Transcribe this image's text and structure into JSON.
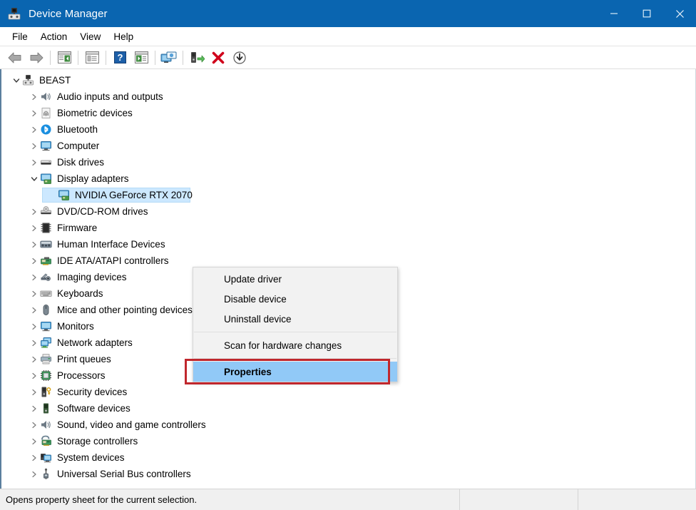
{
  "window": {
    "title": "Device Manager",
    "icon": "device-manager-icon",
    "titlebar_color": "#0a65b0"
  },
  "caption_buttons": [
    {
      "name": "minimize-button",
      "glyph": "minimize"
    },
    {
      "name": "maximize-button",
      "glyph": "maximize"
    },
    {
      "name": "close-button",
      "glyph": "close"
    }
  ],
  "menubar": {
    "items": [
      {
        "label": "File"
      },
      {
        "label": "Action"
      },
      {
        "label": "View"
      },
      {
        "label": "Help"
      }
    ]
  },
  "toolbar": {
    "buttons": [
      {
        "name": "back-icon"
      },
      {
        "name": "forward-icon"
      },
      {
        "name": "show-hide-console-tree-icon"
      },
      {
        "name": "properties-icon"
      },
      {
        "name": "help-icon"
      },
      {
        "name": "show-hide-action-pane-icon"
      },
      {
        "name": "scan-for-hardware-changes-icon"
      },
      {
        "name": "update-driver-icon"
      },
      {
        "name": "uninstall-device-icon"
      },
      {
        "name": "disable-device-icon"
      }
    ]
  },
  "tree": {
    "items": [
      {
        "label": "BEAST",
        "indent": 0,
        "twisty": "expanded",
        "icon": "computer-root-icon"
      },
      {
        "label": "Audio inputs and outputs",
        "indent": 1,
        "twisty": "collapsed",
        "icon": "speaker-icon"
      },
      {
        "label": "Biometric devices",
        "indent": 1,
        "twisty": "collapsed",
        "icon": "fingerprint-icon"
      },
      {
        "label": "Bluetooth",
        "indent": 1,
        "twisty": "collapsed",
        "icon": "bluetooth-icon"
      },
      {
        "label": "Computer",
        "indent": 1,
        "twisty": "collapsed",
        "icon": "monitor-icon"
      },
      {
        "label": "Disk drives",
        "indent": 1,
        "twisty": "collapsed",
        "icon": "disk-drive-icon"
      },
      {
        "label": "Display adapters",
        "indent": 1,
        "twisty": "expanded",
        "icon": "display-adapter-icon"
      },
      {
        "label": "NVIDIA GeForce RTX 2070",
        "indent": 2,
        "twisty": "none",
        "icon": "display-adapter-icon",
        "selected": true
      },
      {
        "label": "DVD/CD-ROM drives",
        "indent": 1,
        "twisty": "collapsed",
        "icon": "dvd-drive-icon"
      },
      {
        "label": "Firmware",
        "indent": 1,
        "twisty": "collapsed",
        "icon": "firmware-chip-icon"
      },
      {
        "label": "Human Interface Devices",
        "indent": 1,
        "twisty": "collapsed",
        "icon": "hid-icon"
      },
      {
        "label": "IDE ATA/ATAPI controllers",
        "indent": 1,
        "twisty": "collapsed",
        "icon": "ide-controller-icon"
      },
      {
        "label": "Imaging devices",
        "indent": 1,
        "twisty": "collapsed",
        "icon": "camera-icon"
      },
      {
        "label": "Keyboards",
        "indent": 1,
        "twisty": "collapsed",
        "icon": "keyboard-icon"
      },
      {
        "label": "Mice and other pointing devices",
        "indent": 1,
        "twisty": "collapsed",
        "icon": "mouse-icon"
      },
      {
        "label": "Monitors",
        "indent": 1,
        "twisty": "collapsed",
        "icon": "monitor-icon"
      },
      {
        "label": "Network adapters",
        "indent": 1,
        "twisty": "collapsed",
        "icon": "network-adapter-icon"
      },
      {
        "label": "Print queues",
        "indent": 1,
        "twisty": "collapsed",
        "icon": "printer-icon"
      },
      {
        "label": "Processors",
        "indent": 1,
        "twisty": "collapsed",
        "icon": "processor-icon"
      },
      {
        "label": "Security devices",
        "indent": 1,
        "twisty": "collapsed",
        "icon": "security-device-icon"
      },
      {
        "label": "Software devices",
        "indent": 1,
        "twisty": "collapsed",
        "icon": "software-device-icon"
      },
      {
        "label": "Sound, video and game controllers",
        "indent": 1,
        "twisty": "collapsed",
        "icon": "speaker-icon"
      },
      {
        "label": "Storage controllers",
        "indent": 1,
        "twisty": "collapsed",
        "icon": "storage-controller-icon"
      },
      {
        "label": "System devices",
        "indent": 1,
        "twisty": "collapsed",
        "icon": "system-device-icon"
      },
      {
        "label": "Universal Serial Bus controllers",
        "indent": 1,
        "twisty": "collapsed",
        "icon": "usb-icon"
      }
    ]
  },
  "context_menu": {
    "items": [
      {
        "label": "Update driver",
        "type": "item"
      },
      {
        "label": "Disable device",
        "type": "item"
      },
      {
        "label": "Uninstall device",
        "type": "item"
      },
      {
        "type": "separator"
      },
      {
        "label": "Scan for hardware changes",
        "type": "item"
      },
      {
        "type": "separator"
      },
      {
        "label": "Properties",
        "type": "item",
        "highlighted": true
      }
    ],
    "highlight_color": "#91c9f7",
    "annotation_color": "#c0272d"
  },
  "statusbar": {
    "message": "Opens property sheet for the current selection."
  }
}
